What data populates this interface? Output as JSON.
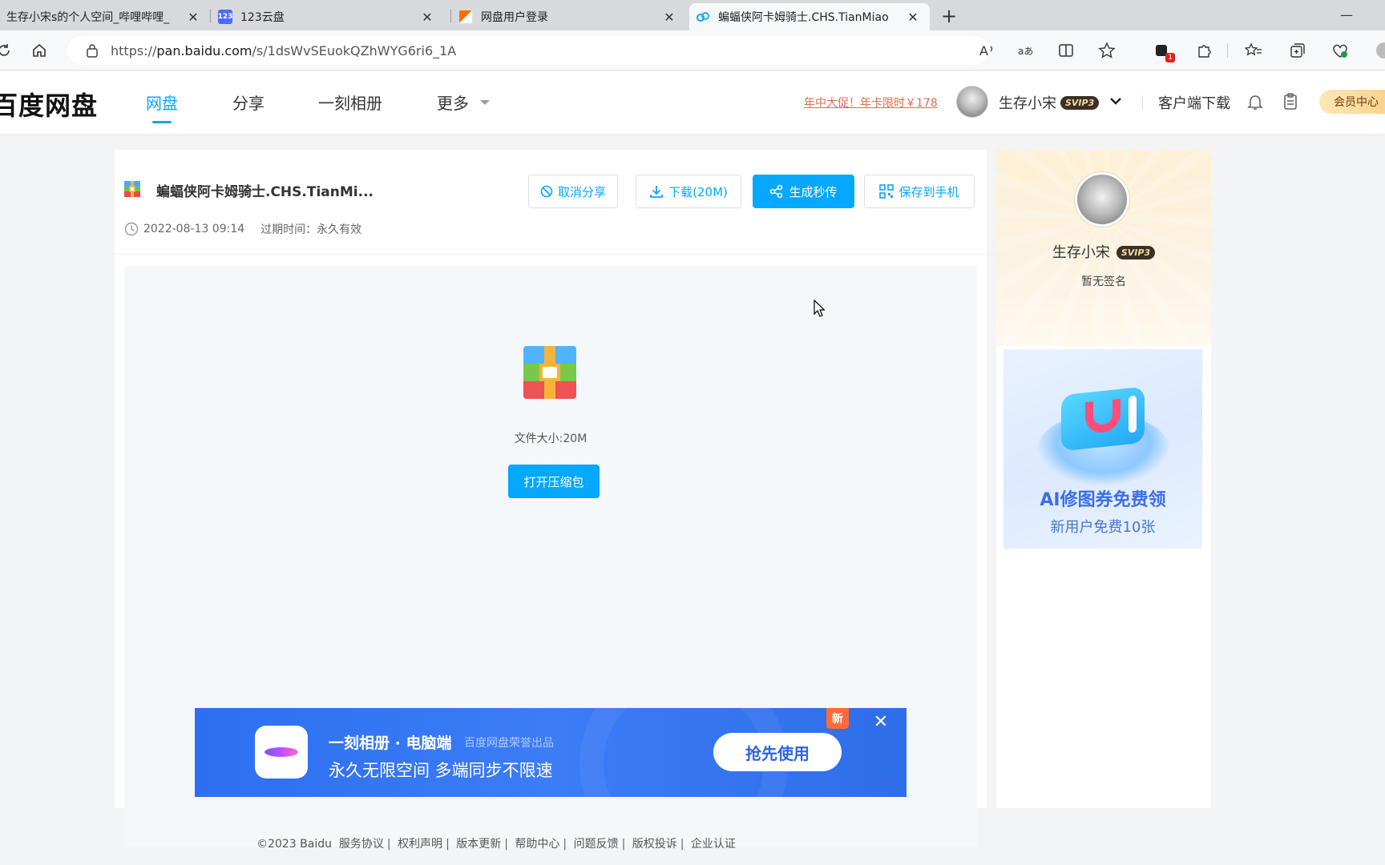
{
  "browser": {
    "tabs": [
      {
        "title": "生存小宋s的个人空间_哔哩哔哩_",
        "icon": "bilibili-icon",
        "active": false
      },
      {
        "title": "123云盘",
        "icon": "123pan-icon",
        "active": false
      },
      {
        "title": "网盘用户登录",
        "icon": "login-page-icon",
        "active": false
      },
      {
        "title": "蝙蝠侠阿卡姆骑士.CHS.TianMiao",
        "icon": "baidu-pan-icon",
        "active": true
      }
    ],
    "url_domain": "pan.baidu.com",
    "url_prefix": "https://",
    "url_path": "/s/1dsWvSEuokQZhWYG6ri6_1A",
    "extension_badge": "1"
  },
  "header": {
    "logo": "百度网盘",
    "nav": [
      {
        "label": "网盘",
        "active": true
      },
      {
        "label": "分享",
        "active": false
      },
      {
        "label": "一刻相册",
        "active": false
      },
      {
        "label": "更多",
        "active": false
      }
    ],
    "promo": "年中大促！年卡限时￥178",
    "username": "生存小宋",
    "svip_badge": "SVIP3",
    "client_download": "客户端下载",
    "vip_center": "会员中心"
  },
  "share": {
    "file_name": "蝙蝠侠阿卡姆骑士.CHS.TianMi...",
    "buttons": {
      "cancel_share": "取消分享",
      "download": "下载(20M)",
      "instant": "生成秒传",
      "save_phone": "保存到手机"
    },
    "date": "2022-08-13 09:14",
    "expire": "过期时间：永久有效",
    "file_size": "文件大小:20M",
    "open_zip": "打开压缩包"
  },
  "banner": {
    "title": "一刻相册 · 电脑端",
    "subtitle": "百度网盘荣誉出品",
    "slogan": "永久无限空间  多端同步不限速",
    "cta": "抢先使用",
    "tag": "新"
  },
  "sidebar": {
    "username": "生存小宋",
    "svip_badge": "SVIP3",
    "signature": "暂无签名",
    "ad_title": "AI修图券免费领",
    "ad_subtitle": "新用户免费10张"
  },
  "footer": {
    "copyright": "©2023 Baidu",
    "links": [
      "服务协议",
      "权利声明",
      "版本更新",
      "帮助中心",
      "问题反馈",
      "版权投诉",
      "企业认证"
    ]
  },
  "colors": {
    "accent": "#06a7ff",
    "promo": "#e06b4f",
    "vip_gold": "#f8cf86"
  }
}
